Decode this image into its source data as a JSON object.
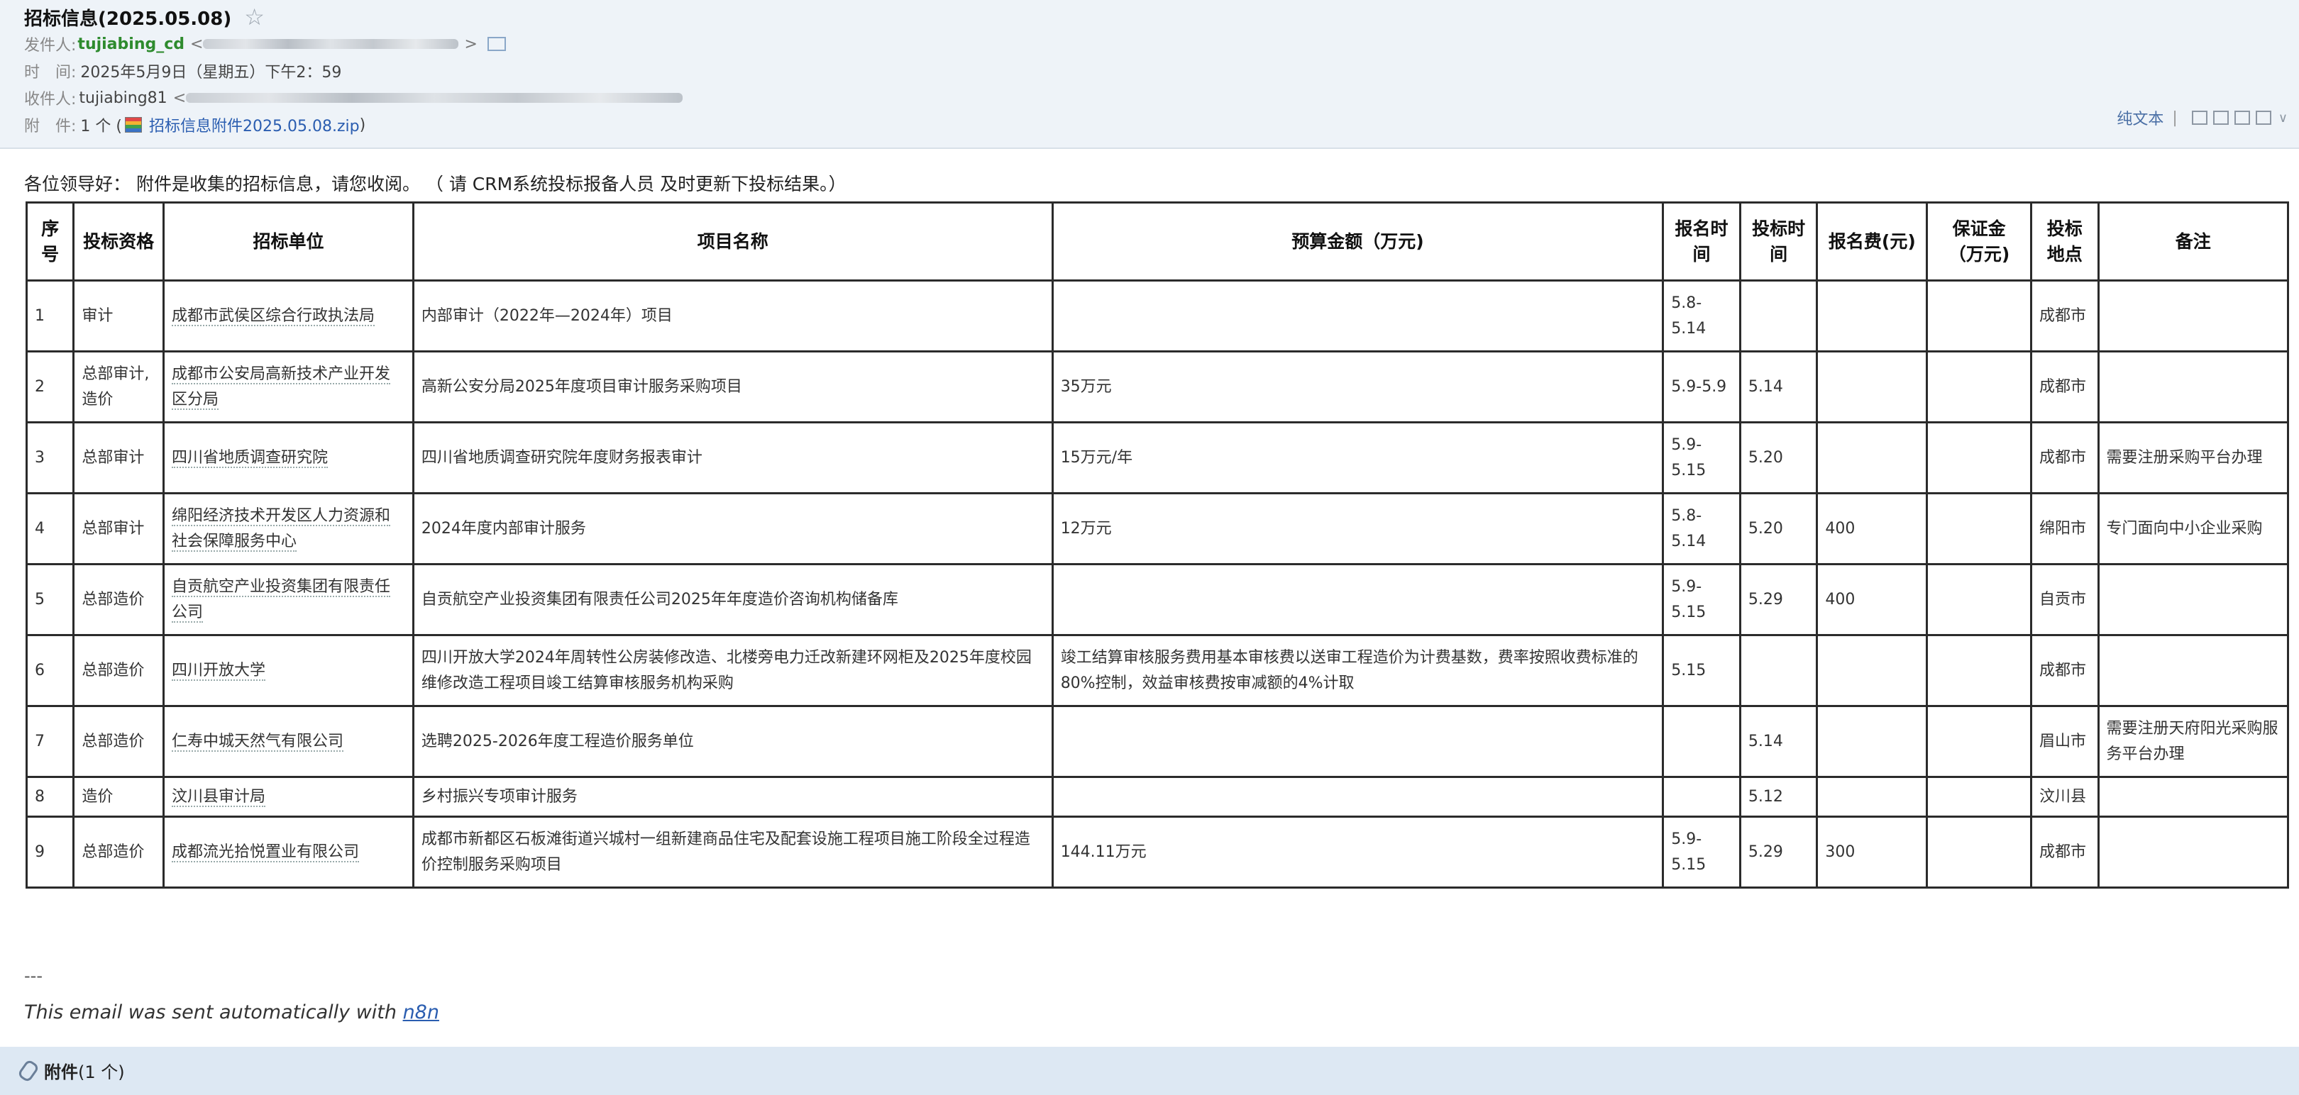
{
  "email": {
    "subject": "招标信息(2025.05.08)",
    "star_icon": "☆",
    "labels": {
      "from": "发件人:",
      "time": "时　间:",
      "to": "收件人:",
      "attachment": "附　件:"
    },
    "from_name": "tujiabing_cd",
    "from_email_prefix": "<",
    "time": "2025年5月9日（星期五）下午2：59",
    "to_name": "tujiabing81",
    "to_email_prefix": "<",
    "attachment_count": "1 个 (",
    "attachment_name": "招标信息附件2025.05.08.zip",
    "attachment_close": ")",
    "toolbar_plain_text": "纯文本",
    "toolbar_sep": "|"
  },
  "body": {
    "greeting": "各位领导好：  附件是收集的招标信息，请您收阅。  （ 请 CRM系统投标报备人员 及时更新下投标结果。）",
    "footer_separator": "---",
    "footer_text": "This email was sent automatically with ",
    "footer_link": "n8n"
  },
  "table": {
    "headers": [
      "序号",
      "投标资格",
      "招标单位",
      "项目名称",
      "预算金额（万元)",
      "报名时间",
      "投标时间",
      "报名费(元)",
      "保证金（万元)",
      "投标地点",
      "备注"
    ],
    "rows": [
      [
        "1",
        "审计",
        "成都市武侯区综合行政执法局",
        "内部审计（2022年—2024年）项目",
        "",
        "5.8-5.14",
        "",
        "",
        "",
        "成都市",
        ""
      ],
      [
        "2",
        "总部审计,造价",
        "成都市公安局高新技术产业开发区分局",
        "高新公安分局2025年度项目审计服务采购项目",
        "35万元",
        "5.9-5.9",
        "5.14",
        "",
        "",
        "成都市",
        ""
      ],
      [
        "3",
        "总部审计",
        "四川省地质调查研究院",
        "四川省地质调查研究院年度财务报表审计",
        "15万元/年",
        "5.9-5.15",
        "5.20",
        "",
        "",
        "成都市",
        "需要注册采购平台办理"
      ],
      [
        "4",
        "总部审计",
        "绵阳经济技术开发区人力资源和社会保障服务中心",
        "2024年度内部审计服务",
        "12万元",
        "5.8-5.14",
        "5.20",
        "400",
        "",
        "绵阳市",
        "专门面向中小企业采购"
      ],
      [
        "5",
        "总部造价",
        "自贡航空产业投资集团有限责任公司",
        "自贡航空产业投资集团有限责任公司2025年年度造价咨询机构储备库",
        "",
        "5.9-5.15",
        "5.29",
        "400",
        "",
        "自贡市",
        ""
      ],
      [
        "6",
        "总部造价",
        "四川开放大学",
        "四川开放大学2024年周转性公房装修改造、北楼旁电力迁改新建环网柜及2025年度校园维修改造工程项目竣工结算审核服务机构采购",
        "竣工结算审核服务费用基本审核费以送审工程造价为计费基数，费率按照收费标准的80%控制，效益审核费按审减额的4%计取",
        "5.15",
        "",
        "",
        "",
        "成都市",
        ""
      ],
      [
        "7",
        "总部造价",
        "仁寿中城天然气有限公司",
        "选聘2025-2026年度工程造价服务单位",
        "",
        "",
        "5.14",
        "",
        "",
        "眉山市",
        "需要注册天府阳光采购服务平台办理"
      ],
      [
        "8",
        "造价",
        "汶川县审计局",
        "乡村振兴专项审计服务",
        "",
        "",
        "5.12",
        "",
        "",
        "汶川县",
        ""
      ],
      [
        "9",
        "总部造价",
        "成都流光拾悦置业有限公司",
        "成都市新都区石板滩街道兴城村一组新建商品住宅及配套设施工程项目施工阶段全过程造价控制服务采购项目",
        "144.11万元",
        "5.9-5.15",
        "5.29",
        "300",
        "",
        "成都市",
        ""
      ]
    ]
  },
  "attachment_bar": {
    "label": "附件",
    "count": "(1 个)"
  }
}
